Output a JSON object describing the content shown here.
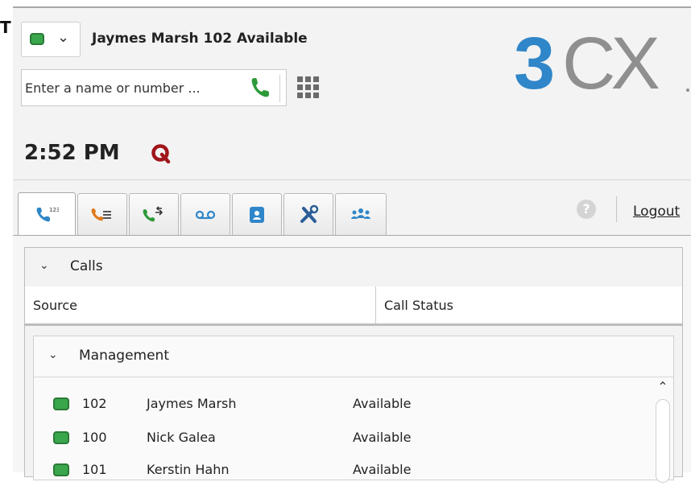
{
  "window": {
    "title_fragment": "T"
  },
  "header": {
    "status_color": "#3aa64c",
    "user_status_line": "Jaymes Marsh 102 Available",
    "dial_placeholder": "Enter a name or number ...",
    "call_icon": "phone-icon",
    "keypad_icon": "dialpad-icon",
    "logo_text": "3CX",
    "logo_color_3": "#2f86c9",
    "logo_color_cx": "#8f8f8f"
  },
  "timebar": {
    "time": "2:52 PM",
    "queue_icon": "queue-q-icon",
    "queue_color": "#a0151a"
  },
  "tabs": [
    {
      "icon": "dialer-icon",
      "active": true
    },
    {
      "icon": "call-log-icon",
      "active": false
    },
    {
      "icon": "transfer-icon",
      "active": false
    },
    {
      "icon": "voicemail-icon",
      "active": false
    },
    {
      "icon": "contacts-icon",
      "active": false
    },
    {
      "icon": "settings-tools-icon",
      "active": false
    },
    {
      "icon": "group-icon",
      "active": false
    }
  ],
  "help_label": "?",
  "logout_label": "Logout",
  "calls": {
    "title": "Calls",
    "columns": [
      "Source",
      "Call Status"
    ]
  },
  "management": {
    "title": "Management",
    "rows": [
      {
        "ext": "102",
        "name": "Jaymes Marsh",
        "status": "Available",
        "led": "#3aa64c"
      },
      {
        "ext": "100",
        "name": "Nick Galea",
        "status": "Available",
        "led": "#3aa64c"
      },
      {
        "ext": "101",
        "name": "Kerstin Hahn",
        "status": "Available",
        "led": "#3aa64c"
      }
    ]
  }
}
